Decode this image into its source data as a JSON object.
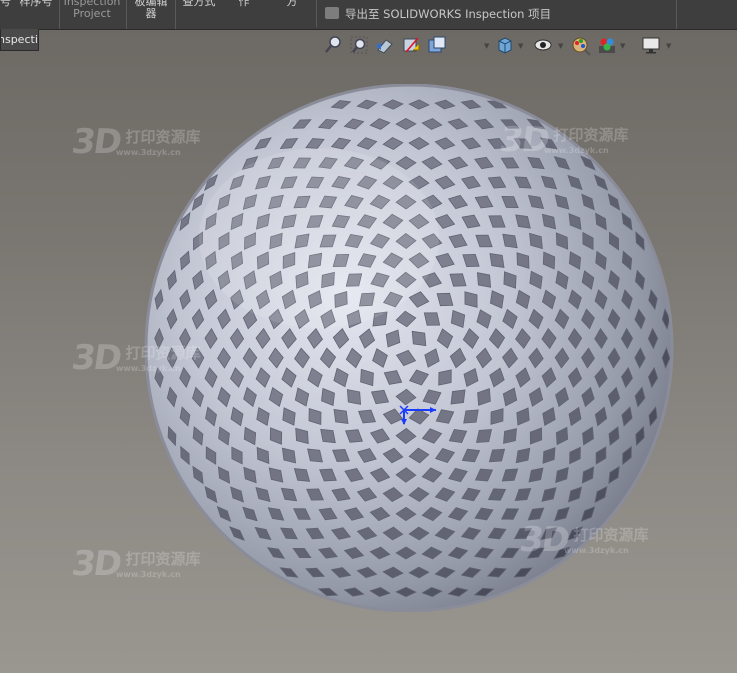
{
  "ribbon": {
    "items": [
      {
        "label": "号"
      },
      {
        "label": "样序号"
      },
      {
        "label": "Inspection\nProject"
      },
      {
        "label": "板编辑\n器"
      },
      {
        "label": "查方式"
      },
      {
        "label": "作"
      },
      {
        "label": "方"
      }
    ],
    "export_label": "导出至 SOLIDWORKS Inspection 项目"
  },
  "tab": {
    "label": "nspection"
  },
  "toolbar": {
    "icons": [
      "zoom-to-fit-icon",
      "zoom-to-area-icon",
      "previous-view-icon",
      "section-view-icon",
      "dynamic-annotation-icon",
      "view-orientation-icon",
      "display-style-icon",
      "hide-show-items-icon",
      "edit-appearance-icon",
      "apply-scene-icon",
      "view-settings-icon"
    ]
  },
  "watermark": {
    "logo": "3D",
    "cn": "打印资源库",
    "url": "www.3dzyk.cn"
  },
  "colors": {
    "background": "#7a7671",
    "ribbon": "#3e3e3e",
    "sphere": "#b8bccb",
    "triad": "#1a3cff"
  }
}
